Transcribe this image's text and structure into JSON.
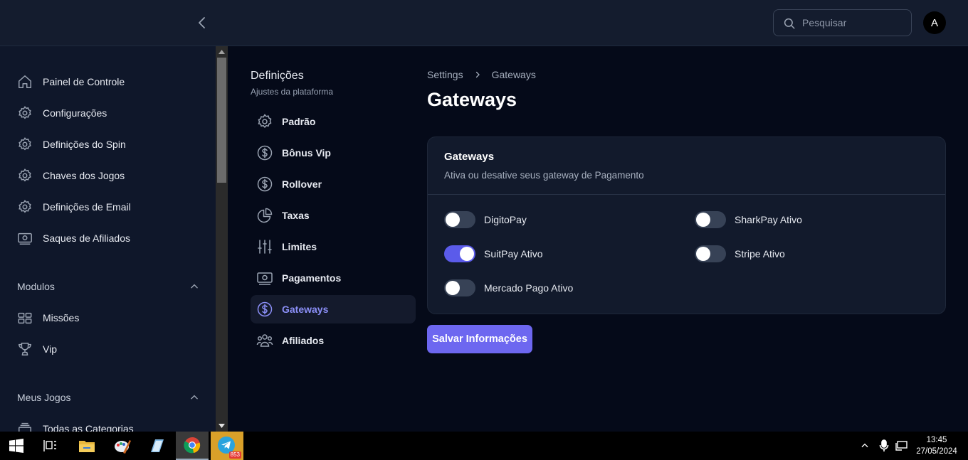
{
  "header": {
    "search_placeholder": "Pesquisar",
    "avatar_initial": "A"
  },
  "sidebar": {
    "items": [
      {
        "label": "Painel de Controle",
        "icon": "home-icon"
      },
      {
        "label": "Configurações",
        "icon": "gear-icon"
      },
      {
        "label": "Definições do Spin",
        "icon": "gear-icon"
      },
      {
        "label": "Chaves dos Jogos",
        "icon": "gear-icon"
      },
      {
        "label": "Definições de Email",
        "icon": "gear-icon"
      },
      {
        "label": "Saques de Afiliados",
        "icon": "cash-icon"
      }
    ],
    "modulos": {
      "title": "Modulos",
      "items": [
        {
          "label": "Missões",
          "icon": "grid-icon"
        },
        {
          "label": "Vip",
          "icon": "trophy-icon"
        }
      ]
    },
    "meus_jogos": {
      "title": "Meus Jogos",
      "items": [
        {
          "label": "Todas as Categorias",
          "icon": "stack-icon"
        }
      ]
    }
  },
  "settings_nav": {
    "title": "Definições",
    "subtitle": "Ajustes da plataforma",
    "items": [
      {
        "label": "Padrão",
        "icon": "gear-icon"
      },
      {
        "label": "Bônus Vip",
        "icon": "dollar-circle-icon"
      },
      {
        "label": "Rollover",
        "icon": "dollar-circle-icon"
      },
      {
        "label": "Taxas",
        "icon": "pie-chart-icon"
      },
      {
        "label": "Limites",
        "icon": "sliders-icon"
      },
      {
        "label": "Pagamentos",
        "icon": "cash-icon"
      },
      {
        "label": "Gateways",
        "icon": "dollar-circle-icon",
        "active": true
      },
      {
        "label": "Afiliados",
        "icon": "users-icon"
      }
    ]
  },
  "main": {
    "breadcrumb": [
      "Settings",
      "Gateways"
    ],
    "title": "Gateways",
    "card": {
      "title": "Gateways",
      "subtitle": "Ativa ou desative seus gateway de Pagamento",
      "toggles": [
        {
          "label": "DigitoPay",
          "on": false
        },
        {
          "label": "SharkPay Ativo",
          "on": false
        },
        {
          "label": "SuitPay Ativo",
          "on": true
        },
        {
          "label": "Stripe Ativo",
          "on": false
        },
        {
          "label": "Mercado Pago Ativo",
          "on": false
        }
      ]
    },
    "save_label": "Salvar Informações"
  },
  "taskbar": {
    "telegram_badge": "853",
    "time": "13:45",
    "date": "27/05/2024"
  },
  "colors": {
    "accent": "#6d67f0",
    "toggle_on": "#5b5bea",
    "active_nav_text": "#8b8ff7"
  }
}
